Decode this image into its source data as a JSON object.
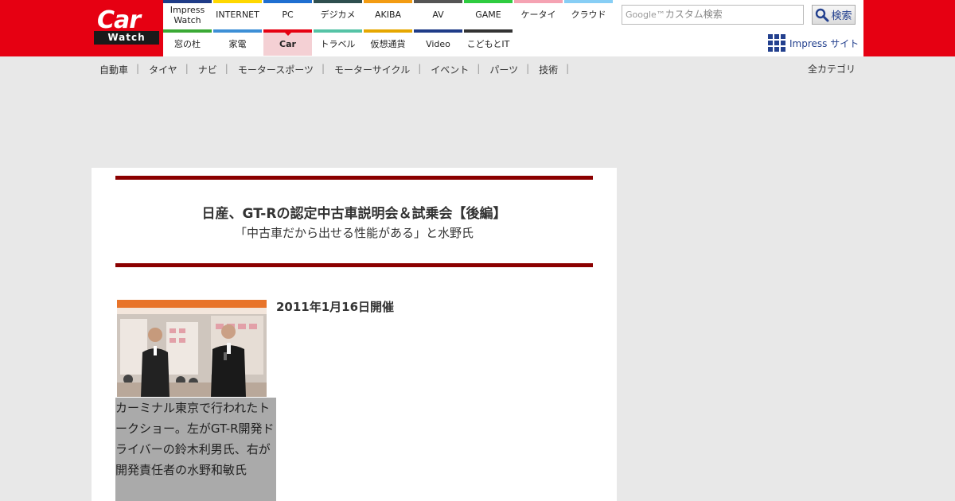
{
  "logo": {
    "main": "Car",
    "sub": "Watch"
  },
  "nav": {
    "row1": [
      {
        "label": "Impress\nWatch",
        "color": "#1f3c88"
      },
      {
        "label": "INTERNET",
        "color": "#ffd800"
      },
      {
        "label": "PC",
        "color": "#1f6fd1"
      },
      {
        "label": "デジカメ",
        "color": "#2f4f4f"
      },
      {
        "label": "AKIBA",
        "color": "#f39c12"
      },
      {
        "label": "AV",
        "color": "#555555"
      },
      {
        "label": "GAME",
        "color": "#2ecc40"
      },
      {
        "label": "ケータイ",
        "color": "#f5a3b3"
      },
      {
        "label": "クラウド",
        "color": "#87cef5"
      }
    ],
    "row2": [
      {
        "label": "窓の杜",
        "color": "#3aa935"
      },
      {
        "label": "家電",
        "color": "#3d8fd6"
      },
      {
        "label": "Car",
        "color": "#e60012",
        "active": true
      },
      {
        "label": "トラベル",
        "color": "#55c3a6"
      },
      {
        "label": "仮想通貨",
        "color": "#e6a700"
      },
      {
        "label": "Video",
        "color": "#1f3c88"
      },
      {
        "label": "こどもとIT",
        "color": "#333333"
      }
    ]
  },
  "search": {
    "google": "Google™",
    "placeholder": "カスタム検索",
    "button_label": "検索"
  },
  "impress_sites": "Impress サイト",
  "categories": [
    "自動車",
    "タイヤ",
    "ナビ",
    "モータースポーツ",
    "モーターサイクル",
    "イベント",
    "パーツ",
    "技術"
  ],
  "all_categories": "全カテゴリ",
  "article": {
    "title": "日産、GT-Rの認定中古車説明会＆試乗会【後編】",
    "subtitle": "「中古車だから出せる性能がある」と水野氏",
    "date": "2011年1月16日開催",
    "caption": "カーミナル東京で行われたトークショー。左がGT-R開発ドライバーの鈴木利男氏、右が開発責任者の水野和敏氏",
    "rule_color": "#8b0000"
  },
  "colors": {
    "brand": "#e60012",
    "link": "#23408e"
  }
}
